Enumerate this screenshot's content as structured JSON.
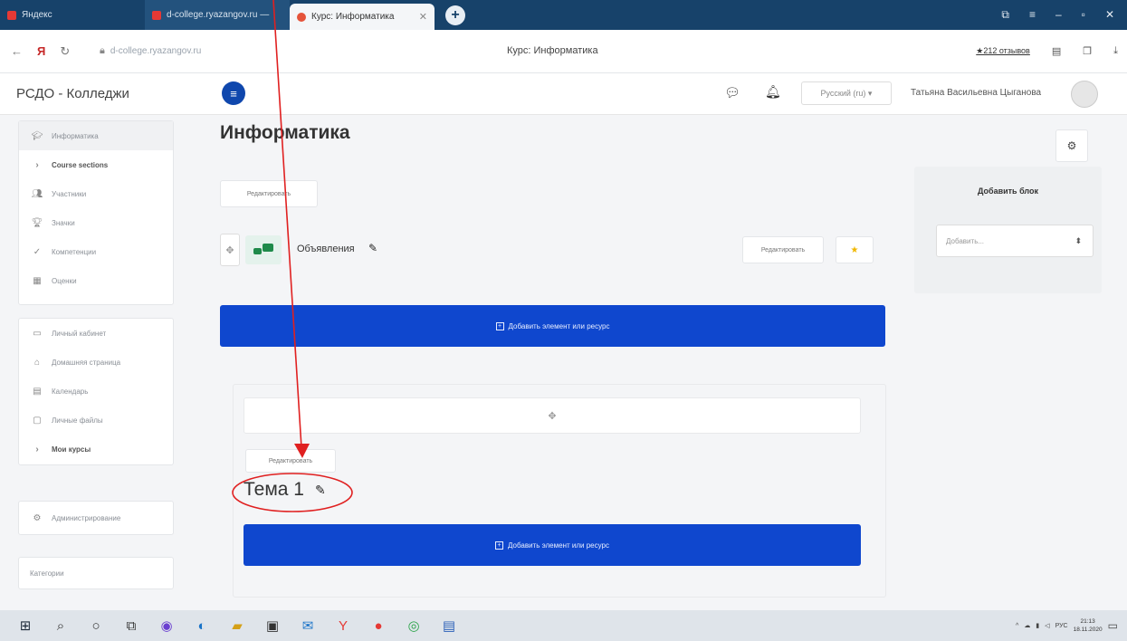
{
  "browser": {
    "tabs": [
      {
        "label": "Яндекс"
      },
      {
        "label": "d-college.ryazangov.ru — "
      },
      {
        "label": "Курс: Информатика"
      }
    ],
    "url": "d-college.ryazangov.ru",
    "page_title": "Курс: Информатика",
    "reviews": "★212 отзывов",
    "colors": {
      "tabbar": "#17426a",
      "accent_blue": "#0f47ce"
    }
  },
  "header": {
    "site_name": "РСДО - Колледжи",
    "language": "Русский (ru) ▾",
    "user_name": "Татьяна Васильевна Цыганова"
  },
  "nav": {
    "course_items": [
      {
        "icon": "graduation-cap-icon",
        "label": "Информатика"
      },
      {
        "icon": "chevron-icon",
        "label": "Course sections"
      },
      {
        "icon": "users-icon",
        "label": "Участники"
      },
      {
        "icon": "trophy-icon",
        "label": "Значки"
      },
      {
        "icon": "check-icon",
        "label": "Компетенции"
      },
      {
        "icon": "grades-icon",
        "label": "Оценки"
      }
    ],
    "site_items": [
      {
        "icon": "dashboard-icon",
        "label": "Личный кабинет"
      },
      {
        "icon": "home-icon",
        "label": "Домашняя страница"
      },
      {
        "icon": "calendar-icon",
        "label": "Календарь"
      },
      {
        "icon": "files-icon",
        "label": "Личные файлы"
      },
      {
        "icon": "chevron-icon",
        "label": "Мои курсы"
      }
    ],
    "admin_label": "Администрирование",
    "categories_label": "Категории"
  },
  "main": {
    "course_title": "Информатика",
    "edit_label": "Редактировать",
    "announcements_label": "Объявления",
    "add_activity_label": "Добавить элемент или ресурс",
    "topic_title": "Тема 1"
  },
  "blocks": {
    "add_block_title": "Добавить блок",
    "add_block_placeholder": "Добавить..."
  },
  "taskbar": {
    "tray_lang": "РУС",
    "time": "21:13",
    "date": "18.11.2020"
  }
}
